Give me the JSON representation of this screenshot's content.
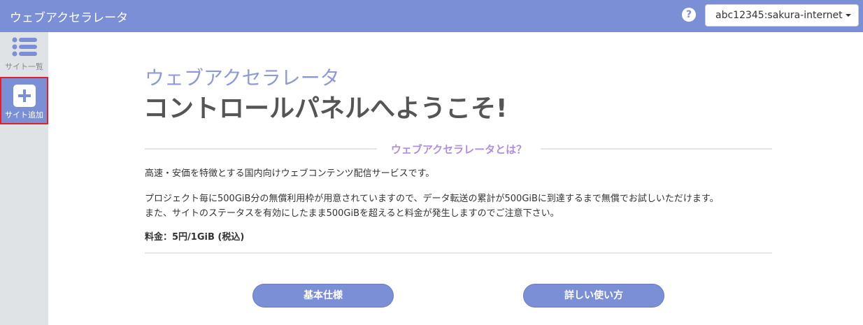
{
  "header": {
    "app_title": "ウェブアクセラレータ",
    "account": "abc12345:sakura-internet"
  },
  "sidebar": {
    "items": [
      {
        "label": "サイト一覧",
        "icon": "list-icon"
      },
      {
        "label": "サイト追加",
        "icon": "plus-icon"
      }
    ]
  },
  "main": {
    "hero_subtitle": "ウェブアクセラレータ",
    "hero_title": "コントロールパネルへようこそ!",
    "section_heading": "ウェブアクセラレータとは？",
    "paragraphs": [
      "高速・安価を特徴とする国内向けウェブコンテンツ配信サービスです。",
      "プロジェクト毎に500GiB分の無償利用枠が用意されていますので、データ転送の累計が500GiBに到達するまで無償でお試しいただけます。",
      "また、サイトのステータスを有効にしたまま500GiBを超えると料金が発生しますのでご注意下さい。"
    ],
    "price": "料金：5円/1GiB (税込)",
    "buttons": {
      "spec": "基本仕様",
      "howto": "詳しい使い方"
    }
  },
  "colors": {
    "accent": "#7b8fd6",
    "heading_purple": "#b08ee2",
    "selected_border": "#e0202a"
  }
}
